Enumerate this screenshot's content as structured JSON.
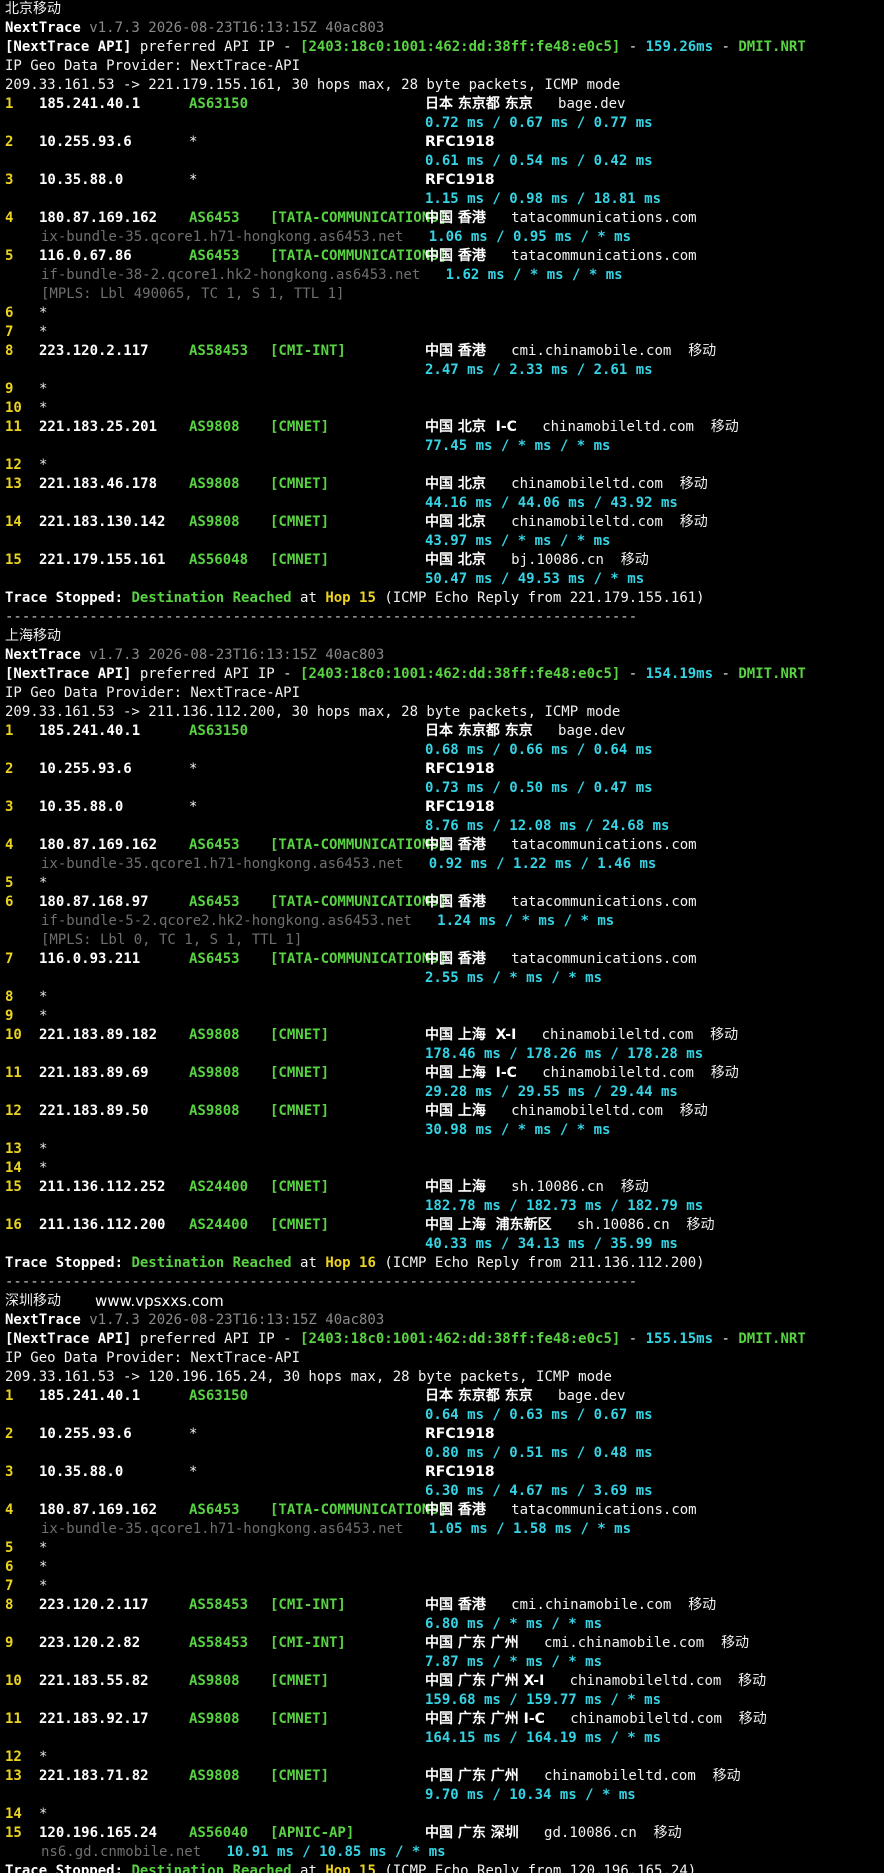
{
  "watermark": "www.vpsxxs.com",
  "sections": [
    {
      "title": "北京移动",
      "version_label": "NextTrace",
      "version_info": " v1.7.3 2026-08-23T16:13:15Z 40ac803",
      "api_label": "[NextTrace API]",
      "api_text": " preferred API IP - ",
      "api_ip": "[2403:18c0:1001:462:dd:38ff:fe48:e0c5]",
      "api_dash": " - ",
      "api_latency": "159.26ms",
      "api_dash2": " - ",
      "api_node": "DMIT.NRT",
      "geo_provider": "IP Geo Data Provider: NextTrace-API",
      "trace_header": "209.33.161.53 -> 221.179.155.161, 30 hops max, 28 byte packets, ICMP mode",
      "hops": [
        {
          "hop": "1",
          "ip": "185.241.40.1",
          "asn": "AS63150",
          "tag": "",
          "geo": "日本 东京都 东京",
          "host": "bage.dev",
          "isp": "",
          "rtt": "0.72 ms / 0.67 ms / 0.77 ms"
        },
        {
          "hop": "2",
          "ip": "10.255.93.6",
          "asn": "*",
          "tag": "",
          "geo": "RFC1918",
          "host": "",
          "isp": "",
          "rtt": "0.61 ms / 0.54 ms / 0.42 ms"
        },
        {
          "hop": "3",
          "ip": "10.35.88.0",
          "asn": "*",
          "tag": "",
          "geo": "RFC1918",
          "host": "",
          "isp": "",
          "rtt": "1.15 ms / 0.98 ms / 18.81 ms"
        },
        {
          "hop": "4",
          "ip": "180.87.169.162",
          "asn": "AS6453",
          "tag": "[TATA-COMMUNICATIONS]",
          "geo": "中国 香港",
          "host": "tatacommunications.com",
          "isp": "",
          "ptr": "ix-bundle-35.qcore1.h71-hongkong.as6453.net",
          "rtt": "1.06 ms / 0.95 ms / * ms",
          "rtt_inline": true
        },
        {
          "hop": "5",
          "ip": "116.0.67.86",
          "asn": "AS6453",
          "tag": "[TATA-COMMUNICATIONS]",
          "geo": "中国 香港",
          "host": "tatacommunications.com",
          "isp": "",
          "ptr": "if-bundle-38-2.qcore1.hk2-hongkong.as6453.net",
          "rtt": "1.62 ms / * ms / * ms",
          "rtt_inline": true,
          "mpls": "[MPLS: Lbl 490065, TC 1, S 1, TTL 1]"
        },
        {
          "hop": "6",
          "star": true
        },
        {
          "hop": "7",
          "star": true
        },
        {
          "hop": "8",
          "ip": "223.120.2.117",
          "asn": "AS58453",
          "tag": "[CMI-INT]",
          "geo": "中国 香港",
          "host": "cmi.chinamobile.com",
          "isp": "移动",
          "rtt": "2.47 ms / 2.33 ms / 2.61 ms"
        },
        {
          "hop": "9",
          "star": true
        },
        {
          "hop": "10",
          "star": true
        },
        {
          "hop": "11",
          "ip": "221.183.25.201",
          "asn": "AS9808",
          "tag": "[CMNET]",
          "geo": "中国 北京  I-C",
          "host": "chinamobileltd.com",
          "isp": "移动",
          "rtt": "77.45 ms / * ms / * ms"
        },
        {
          "hop": "12",
          "star": true
        },
        {
          "hop": "13",
          "ip": "221.183.46.178",
          "asn": "AS9808",
          "tag": "[CMNET]",
          "geo": "中国 北京",
          "host": "chinamobileltd.com",
          "isp": "移动",
          "rtt": "44.16 ms / 44.06 ms / 43.92 ms"
        },
        {
          "hop": "14",
          "ip": "221.183.130.142",
          "asn": "AS9808",
          "tag": "[CMNET]",
          "geo": "中国 北京",
          "host": "chinamobileltd.com",
          "isp": "移动",
          "rtt": "43.97 ms / * ms / * ms"
        },
        {
          "hop": "15",
          "ip": "221.179.155.161",
          "asn": "AS56048",
          "tag": "[CMNET]",
          "geo": "中国 北京",
          "host": "bj.10086.cn",
          "isp": "移动",
          "rtt": "50.47 ms / 49.53 ms / * ms"
        }
      ],
      "stop_label": "Trace Stopped: ",
      "stop_status": "Destination Reached",
      "stop_at": " at ",
      "stop_hop": "Hop 15",
      "stop_detail": " (ICMP Echo Reply from 221.179.155.161)"
    },
    {
      "title": "上海移动",
      "version_label": "NextTrace",
      "version_info": " v1.7.3 2026-08-23T16:13:15Z 40ac803",
      "api_label": "[NextTrace API]",
      "api_text": " preferred API IP - ",
      "api_ip": "[2403:18c0:1001:462:dd:38ff:fe48:e0c5]",
      "api_dash": " - ",
      "api_latency": "154.19ms",
      "api_dash2": " - ",
      "api_node": "DMIT.NRT",
      "geo_provider": "IP Geo Data Provider: NextTrace-API",
      "trace_header": "209.33.161.53 -> 211.136.112.200, 30 hops max, 28 byte packets, ICMP mode",
      "hops": [
        {
          "hop": "1",
          "ip": "185.241.40.1",
          "asn": "AS63150",
          "tag": "",
          "geo": "日本 东京都 东京",
          "host": "bage.dev",
          "isp": "",
          "rtt": "0.68 ms / 0.66 ms / 0.64 ms"
        },
        {
          "hop": "2",
          "ip": "10.255.93.6",
          "asn": "*",
          "tag": "",
          "geo": "RFC1918",
          "host": "",
          "isp": "",
          "rtt": "0.73 ms / 0.50 ms / 0.47 ms"
        },
        {
          "hop": "3",
          "ip": "10.35.88.0",
          "asn": "*",
          "tag": "",
          "geo": "RFC1918",
          "host": "",
          "isp": "",
          "rtt": "8.76 ms / 12.08 ms / 24.68 ms"
        },
        {
          "hop": "4",
          "ip": "180.87.169.162",
          "asn": "AS6453",
          "tag": "[TATA-COMMUNICATIONS]",
          "geo": "中国 香港",
          "host": "tatacommunications.com",
          "isp": "",
          "ptr": "ix-bundle-35.qcore1.h71-hongkong.as6453.net",
          "rtt": "0.92 ms / 1.22 ms / 1.46 ms",
          "rtt_inline": true
        },
        {
          "hop": "5",
          "star": true
        },
        {
          "hop": "6",
          "ip": "180.87.168.97",
          "asn": "AS6453",
          "tag": "[TATA-COMMUNICATIONS]",
          "geo": "中国 香港",
          "host": "tatacommunications.com",
          "isp": "",
          "ptr": "if-bundle-5-2.qcore2.hk2-hongkong.as6453.net",
          "rtt": "1.24 ms / * ms / * ms",
          "rtt_inline": true,
          "mpls": "[MPLS: Lbl 0, TC 1, S 1, TTL 1]"
        },
        {
          "hop": "7",
          "ip": "116.0.93.211",
          "asn": "AS6453",
          "tag": "[TATA-COMMUNICATIONS]",
          "geo": "中国 香港",
          "host": "tatacommunications.com",
          "isp": "",
          "rtt": "2.55 ms / * ms / * ms"
        },
        {
          "hop": "8",
          "star": true
        },
        {
          "hop": "9",
          "star": true
        },
        {
          "hop": "10",
          "ip": "221.183.89.182",
          "asn": "AS9808",
          "tag": "[CMNET]",
          "geo": "中国 上海  X-I",
          "host": "chinamobileltd.com",
          "isp": "移动",
          "rtt": "178.46 ms / 178.26 ms / 178.28 ms"
        },
        {
          "hop": "11",
          "ip": "221.183.89.69",
          "asn": "AS9808",
          "tag": "[CMNET]",
          "geo": "中国 上海  I-C",
          "host": "chinamobileltd.com",
          "isp": "移动",
          "rtt": "29.28 ms / 29.55 ms / 29.44 ms"
        },
        {
          "hop": "12",
          "ip": "221.183.89.50",
          "asn": "AS9808",
          "tag": "[CMNET]",
          "geo": "中国 上海",
          "host": "chinamobileltd.com",
          "isp": "移动",
          "rtt": "30.98 ms / * ms / * ms"
        },
        {
          "hop": "13",
          "star": true
        },
        {
          "hop": "14",
          "star": true
        },
        {
          "hop": "15",
          "ip": "211.136.112.252",
          "asn": "AS24400",
          "tag": "[CMNET]",
          "geo": "中国 上海",
          "host": "sh.10086.cn",
          "isp": "移动",
          "rtt": "182.78 ms / 182.73 ms / 182.79 ms"
        },
        {
          "hop": "16",
          "ip": "211.136.112.200",
          "asn": "AS24400",
          "tag": "[CMNET]",
          "geo": "中国 上海  浦东新区",
          "host": "sh.10086.cn",
          "isp": "移动",
          "rtt": "40.33 ms / 34.13 ms / 35.99 ms"
        }
      ],
      "stop_label": "Trace Stopped: ",
      "stop_status": "Destination Reached",
      "stop_at": " at ",
      "stop_hop": "Hop 16",
      "stop_detail": " (ICMP Echo Reply from 211.136.112.200)"
    },
    {
      "title": "深圳移动",
      "version_label": "NextTrace",
      "version_info": " v1.7.3 2026-08-23T16:13:15Z 40ac803",
      "api_label": "[NextTrace API]",
      "api_text": " preferred API IP - ",
      "api_ip": "[2403:18c0:1001:462:dd:38ff:fe48:e0c5]",
      "api_dash": " - ",
      "api_latency": "155.15ms",
      "api_dash2": " - ",
      "api_node": "DMIT.NRT",
      "geo_provider": "IP Geo Data Provider: NextTrace-API",
      "trace_header": "209.33.161.53 -> 120.196.165.24, 30 hops max, 28 byte packets, ICMP mode",
      "hops": [
        {
          "hop": "1",
          "ip": "185.241.40.1",
          "asn": "AS63150",
          "tag": "",
          "geo": "日本 东京都 东京",
          "host": "bage.dev",
          "isp": "",
          "rtt": "0.64 ms / 0.63 ms / 0.67 ms"
        },
        {
          "hop": "2",
          "ip": "10.255.93.6",
          "asn": "*",
          "tag": "",
          "geo": "RFC1918",
          "host": "",
          "isp": "",
          "rtt": "0.80 ms / 0.51 ms / 0.48 ms"
        },
        {
          "hop": "3",
          "ip": "10.35.88.0",
          "asn": "*",
          "tag": "",
          "geo": "RFC1918",
          "host": "",
          "isp": "",
          "rtt": "6.30 ms / 4.67 ms / 3.69 ms"
        },
        {
          "hop": "4",
          "ip": "180.87.169.162",
          "asn": "AS6453",
          "tag": "[TATA-COMMUNICATIONS]",
          "geo": "中国 香港",
          "host": "tatacommunications.com",
          "isp": "",
          "ptr": "ix-bundle-35.qcore1.h71-hongkong.as6453.net",
          "rtt": "1.05 ms / 1.58 ms / * ms",
          "rtt_inline": true
        },
        {
          "hop": "5",
          "star": true
        },
        {
          "hop": "6",
          "star": true
        },
        {
          "hop": "7",
          "star": true
        },
        {
          "hop": "8",
          "ip": "223.120.2.117",
          "asn": "AS58453",
          "tag": "[CMI-INT]",
          "geo": "中国 香港",
          "host": "cmi.chinamobile.com",
          "isp": "移动",
          "rtt": "6.80 ms / * ms / * ms"
        },
        {
          "hop": "9",
          "ip": "223.120.2.82",
          "asn": "AS58453",
          "tag": "[CMI-INT]",
          "geo": "中国 广东 广州",
          "host": "cmi.chinamobile.com",
          "isp": "移动",
          "rtt": "7.87 ms / * ms / * ms"
        },
        {
          "hop": "10",
          "ip": "221.183.55.82",
          "asn": "AS9808",
          "tag": "[CMNET]",
          "geo": "中国 广东 广州 X-I",
          "host": "chinamobileltd.com",
          "isp": "移动",
          "rtt": "159.68 ms / 159.77 ms / * ms"
        },
        {
          "hop": "11",
          "ip": "221.183.92.17",
          "asn": "AS9808",
          "tag": "[CMNET]",
          "geo": "中国 广东 广州 I-C",
          "host": "chinamobileltd.com",
          "isp": "移动",
          "rtt": "164.15 ms / 164.19 ms / * ms"
        },
        {
          "hop": "12",
          "star": true
        },
        {
          "hop": "13",
          "ip": "221.183.71.82",
          "asn": "AS9808",
          "tag": "[CMNET]",
          "geo": "中国 广东 广州",
          "host": "chinamobileltd.com",
          "isp": "移动",
          "rtt": "9.70 ms / 10.34 ms / * ms"
        },
        {
          "hop": "14",
          "star": true
        },
        {
          "hop": "15",
          "ip": "120.196.165.24",
          "asn": "AS56040",
          "tag": "[APNIC-AP]",
          "geo": "中国 广东 深圳",
          "host": "gd.10086.cn",
          "isp": "移动",
          "ptr": "ns6.gd.cnmobile.net",
          "rtt": "10.91 ms / 10.85 ms / * ms",
          "rtt_inline": true
        }
      ],
      "stop_label": "Trace Stopped: ",
      "stop_status": "Destination Reached",
      "stop_at": " at ",
      "stop_hop": "Hop 15",
      "stop_detail": " (ICMP Echo Reply from 120.196.165.24)"
    }
  ],
  "separator": "---------------------------------------------------------------------------",
  "colors": {
    "background": "#000000",
    "hop_number": "#ecd321",
    "asn": "#59d243",
    "rtt": "#36d3e4",
    "dim": "#8a8a8a"
  }
}
